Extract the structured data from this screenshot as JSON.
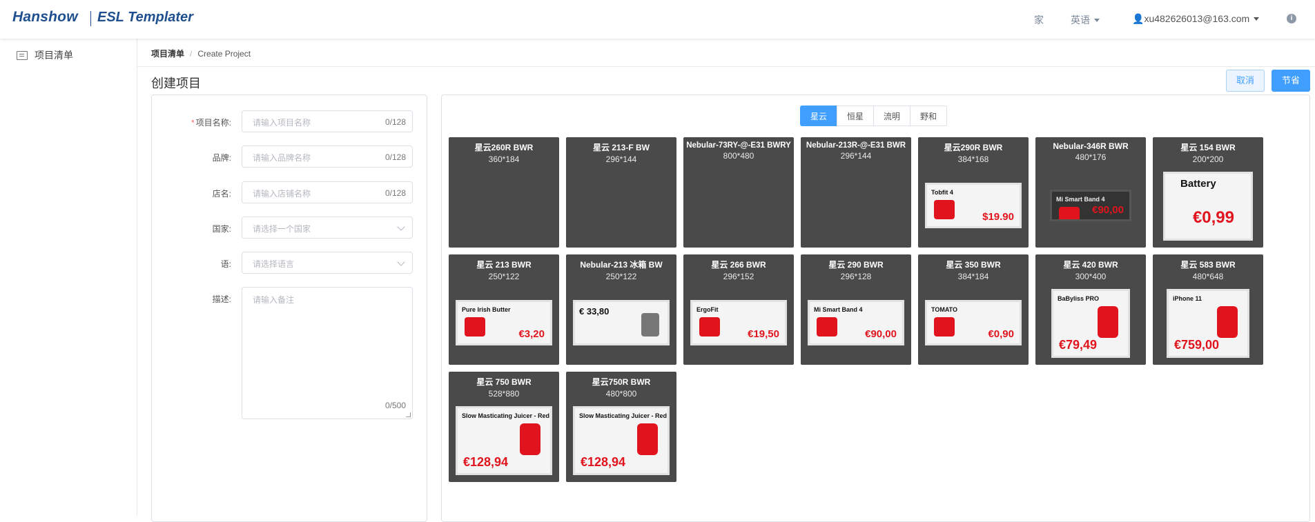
{
  "header": {
    "brand": "Hanshow",
    "product": "ESL Templater",
    "nav_home": "家",
    "nav_lang": "英语",
    "user": "xu482626013@163.com",
    "info_icon": "info-icon"
  },
  "sidebar": {
    "items": [
      {
        "label": "项目清单",
        "icon": "list-icon"
      }
    ]
  },
  "breadcrumb": {
    "root": "项目清单",
    "separator": "/",
    "current": "Create Project"
  },
  "page": {
    "title": "创建项目",
    "cancel_label": "取消",
    "save_label": "节省"
  },
  "form": {
    "fields": [
      {
        "label": "项目名称:",
        "required": true,
        "placeholder": "请输入项目名称",
        "count": "0/128"
      },
      {
        "label": "品牌:",
        "required": false,
        "placeholder": "请输入品牌名称",
        "count": "0/128"
      },
      {
        "label": "店名:",
        "required": false,
        "placeholder": "请输入店铺名称",
        "count": "0/128"
      },
      {
        "label": "国家:",
        "required": false,
        "placeholder": "请选择一个国家",
        "type": "select"
      },
      {
        "label": "语:",
        "required": false,
        "placeholder": "请选择语言",
        "type": "select"
      }
    ],
    "description": {
      "label": "描述:",
      "placeholder": "请输入备注",
      "count": "0/500"
    }
  },
  "tabs": [
    {
      "label": "星云",
      "active": true
    },
    {
      "label": "恒星",
      "active": false
    },
    {
      "label": "流明",
      "active": false
    },
    {
      "label": "野和",
      "active": false
    }
  ],
  "templates": [
    {
      "name": "星云260R BWR",
      "size": "360*184",
      "preview": null
    },
    {
      "name": "星云 213-F BW",
      "size": "296*144",
      "preview": null
    },
    {
      "name": "Nebular-73RY-@-E31 BWRY",
      "size": "800*480",
      "preview": null
    },
    {
      "name": "Nebular-213R-@-E31 BWR",
      "size": "296*144",
      "preview": null
    },
    {
      "name": "星云290R BWR",
      "size": "384*168",
      "preview": {
        "title": "Tobfit 4",
        "price": "$19.90"
      }
    },
    {
      "name": "Nebular-346R BWR",
      "size": "480*176",
      "preview": {
        "title": "Mi Smart Band 4",
        "price": "€90,00"
      }
    },
    {
      "name": "星云 154 BWR",
      "size": "200*200",
      "preview": {
        "title": "Battery",
        "price": "€0,99"
      }
    },
    {
      "name": "星云 213 BWR",
      "size": "250*122",
      "preview": {
        "title": "Pure Irish Butter",
        "price": "€3,20"
      }
    },
    {
      "name": "Nebular-213 冰箱 BW",
      "size": "250*122",
      "preview": {
        "title": "€ 33,80",
        "price": ""
      }
    },
    {
      "name": "星云 266 BWR",
      "size": "296*152",
      "preview": {
        "title": "ErgoFit",
        "price": "€19,50"
      }
    },
    {
      "name": "星云 290 BWR",
      "size": "296*128",
      "preview": {
        "title": "Mi Smart Band 4",
        "price": "€90,00"
      }
    },
    {
      "name": "星云 350 BWR",
      "size": "384*184",
      "preview": {
        "title": "TOMATO",
        "price": "€0,90"
      }
    },
    {
      "name": "星云 420 BWR",
      "size": "300*400",
      "preview": {
        "title": "BaByliss PRO",
        "price": "€79,49"
      }
    },
    {
      "name": "星云 583 BWR",
      "size": "480*648",
      "preview": {
        "title": "iPhone 11",
        "price": "€759,00"
      }
    },
    {
      "name": "星云 750 BWR",
      "size": "528*880",
      "preview": {
        "title": "Slow Masticating Juicer - Red",
        "price": "€128,94"
      }
    },
    {
      "name": "星云750R BWR",
      "size": "480*800",
      "preview": {
        "title": "Slow Masticating Juicer - Red",
        "price": "€128,94"
      }
    }
  ],
  "colors": {
    "primary": "#409eff",
    "card_bg": "#4a4a4a",
    "brand": "#1f4f8f",
    "price_red": "#e1141e"
  }
}
